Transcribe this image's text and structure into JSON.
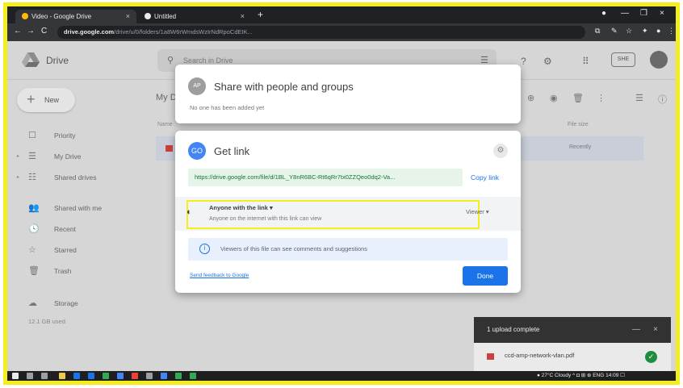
{
  "browser": {
    "tabs": [
      {
        "title": "Video - Google Drive",
        "close": "×"
      },
      {
        "title": "Untitled",
        "close": "×"
      }
    ],
    "new_tab": "+",
    "window_controls": [
      "●",
      "—",
      "❐",
      "×"
    ],
    "nav": [
      "←",
      "→",
      "C"
    ],
    "address_host": "drive.google.com",
    "address_path": "/drive/u/0/folders/1a8W6rWmdsWzIrNdRpoCdEIK..."
  },
  "drive": {
    "logo_text": "Drive",
    "search_placeholder": "Search in Drive",
    "header_badge": "SHE",
    "new_label": "New",
    "sidebar": [
      {
        "label": "Priority",
        "icon": "☐"
      },
      {
        "label": "My Drive",
        "icon": "☰",
        "expand": "▸"
      },
      {
        "label": "Shared drives",
        "icon": "☷",
        "expand": "▸"
      },
      {
        "label": "Shared with me",
        "icon": "👥"
      },
      {
        "label": "Recent",
        "icon": "🕓"
      },
      {
        "label": "Starred",
        "icon": "☆"
      },
      {
        "label": "Trash",
        "icon": "🗑"
      },
      {
        "label": "Storage",
        "icon": "☁"
      }
    ],
    "storage_used": "12.1 GB used",
    "breadcrumb": "My Drive  >  Video  ▾",
    "columns": {
      "name": "Name",
      "modified": "File size"
    },
    "row_owner": "Recently"
  },
  "share_dialog": {
    "avatar": "AP",
    "title": "Share with people and groups",
    "subtitle": "No one has been added yet"
  },
  "link_dialog": {
    "icon": "GO",
    "title": "Get link",
    "url": "https://drive.google.com/file/d/1BL_Y8nR6BC-Rt6qRr7tx0ZZQeo0dq2-Va...",
    "copy_label": "Copy link",
    "access_name": "Anyone with the link  ▾",
    "access_desc": "Anyone on the internet with this link can view",
    "role": "Viewer  ▾",
    "info_text": "Viewers of this file can see comments and suggestions",
    "feedback": "Send feedback to Google",
    "done_label": "Done"
  },
  "upload": {
    "header": "1 upload complete",
    "minimize": "—",
    "close": "×",
    "filename": "ccd-amp-network-vlan.pdf",
    "status_icon": "✓"
  },
  "taskbar": {
    "tray_text": "● 27°C Cloudy  ^  ◘  ⊞  ⊕  ENG  14:09  ☐"
  },
  "colors": {
    "highlight": "#f5ee1f",
    "accent": "#1a73e8",
    "link_green": "#137333"
  }
}
